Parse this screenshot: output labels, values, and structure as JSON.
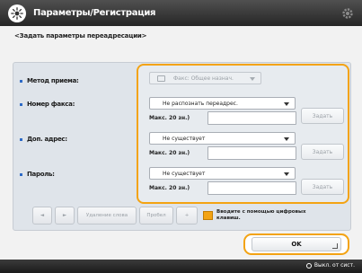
{
  "window": {
    "title": "Параметры/Регистрация"
  },
  "subtitle": "<Задать параметры переадресации>",
  "form": {
    "method": {
      "label": "Метод приема:",
      "value": "Факс: Общее назнач."
    },
    "fax_number": {
      "label": "Номер факса:",
      "value": "Не распознать переадрес.",
      "max_label": "Макс. 20 зн.)",
      "set_button": "Задать"
    },
    "sub_address": {
      "label": "Доп. адрес:",
      "value": "Не существует",
      "max_label": "Макс. 20 зн.)",
      "set_button": "Задать"
    },
    "password": {
      "label": "Пароль:",
      "value": "Не существует",
      "max_label": "Макс. 20 зн.)",
      "set_button": "Задать"
    }
  },
  "footer": {
    "prev_arrow": "◄",
    "next_arrow": "►",
    "backspace": "Удаление слова",
    "space": "Пробел",
    "plus": "+",
    "numeric_toggle": "Вводите с помощью цифровых клавиш."
  },
  "ok_button": "OK",
  "status": {
    "right_text": "Выкл. от сист."
  },
  "colors": {
    "highlight": "#f3a313",
    "titlebar": "#262626",
    "bullet": "#2d6ac6"
  }
}
